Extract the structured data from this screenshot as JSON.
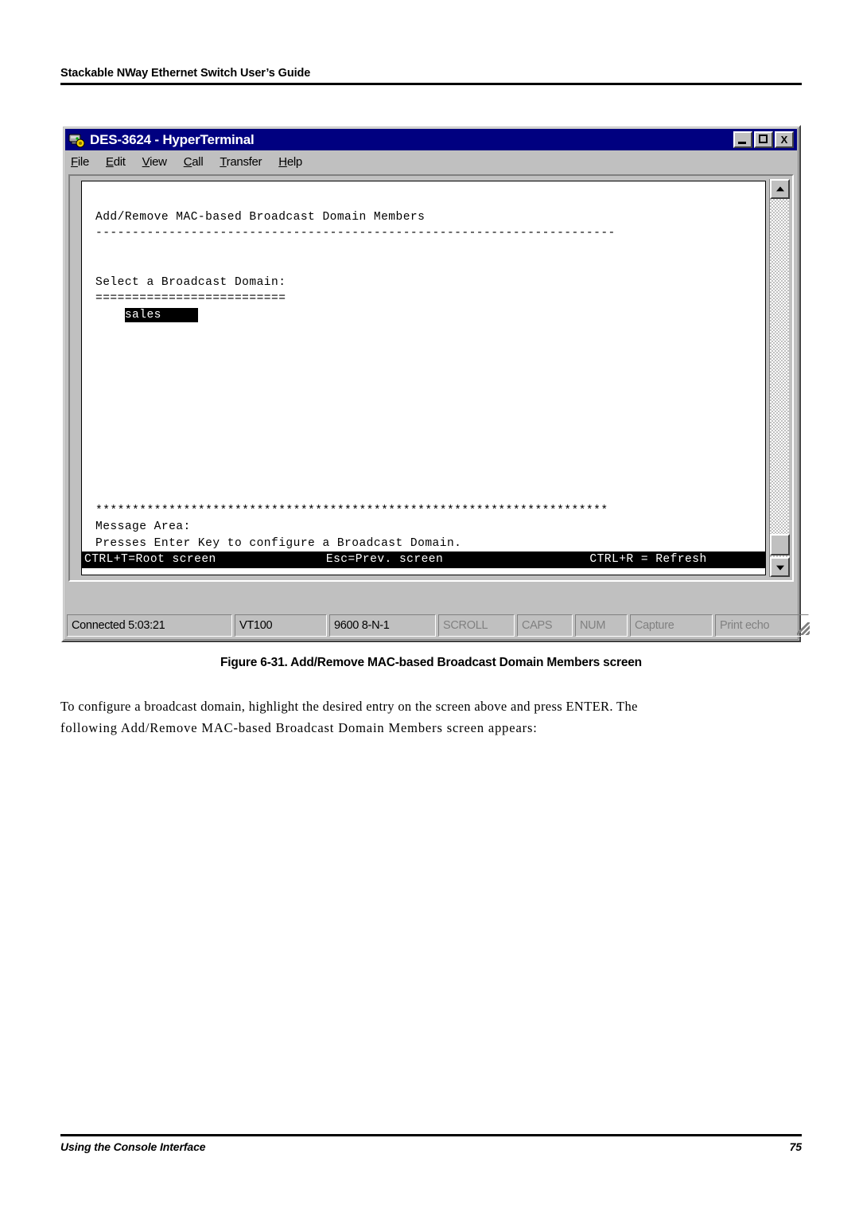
{
  "page": {
    "header_title": "Stackable NWay Ethernet Switch User’s Guide",
    "footer_section": "Using the Console Interface",
    "footer_page_number": "75"
  },
  "figure": {
    "caption": "Figure 6-31.  Add/Remove MAC-based Broadcast Domain Members screen"
  },
  "body": {
    "line1": "To configure a broadcast domain, highlight the desired entry on the screen above and press ENTER. The",
    "line2": "following Add/Remove MAC-based Broadcast Domain Members screen appears:"
  },
  "window": {
    "title": "DES-3624 - HyperTerminal",
    "icon": "modem-icon",
    "controls": {
      "minimize": "minimize-button",
      "maximize": "maximize-button",
      "close_label": "X"
    },
    "menu": [
      {
        "label": "File",
        "accel": "F",
        "rest": "ile"
      },
      {
        "label": "Edit",
        "accel": "E",
        "rest": "dit"
      },
      {
        "label": "View",
        "accel": "V",
        "rest": "iew"
      },
      {
        "label": "Call",
        "accel": "C",
        "rest": "all"
      },
      {
        "label": "Transfer",
        "accel": "T",
        "rest": "ransfer"
      },
      {
        "label": "Help",
        "accel": "H",
        "rest": "elp"
      }
    ]
  },
  "terminal": {
    "title_line": "Add/Remove MAC-based Broadcast Domain Members",
    "rule_dashed": "-----------------------------------------------------------------------",
    "prompt_label": "Select a Broadcast Domain:",
    "prompt_underline": "==========================",
    "selected_domain": "sales",
    "selected_domain_padding": "     ",
    "rule_asterisk": "**********************************************************************",
    "message_area_label": "Message Area:",
    "message_text": "Presses Enter Key to configure a Broadcast Domain.",
    "footer_bar": {
      "left": "CTRL+T=Root screen",
      "center": "Esc=Prev. screen",
      "right": "CTRL+R = Refresh",
      "gap1": "               ",
      "gap2": "                    "
    }
  },
  "statusbar": {
    "connected": "Connected 5:03:21",
    "emulation": "VT100",
    "line_settings": "9600 8-N-1",
    "scroll": "SCROLL",
    "caps": "CAPS",
    "num": "NUM",
    "capture": "Capture",
    "print_echo": "Print echo"
  },
  "colors": {
    "titlebar": "#000080",
    "window_face": "#c0c0c0",
    "terminal_bg": "#ffffff",
    "terminal_fg": "#000000",
    "highlight_bg": "#000000",
    "highlight_fg": "#ffffff",
    "disabled_text": "#808080"
  }
}
